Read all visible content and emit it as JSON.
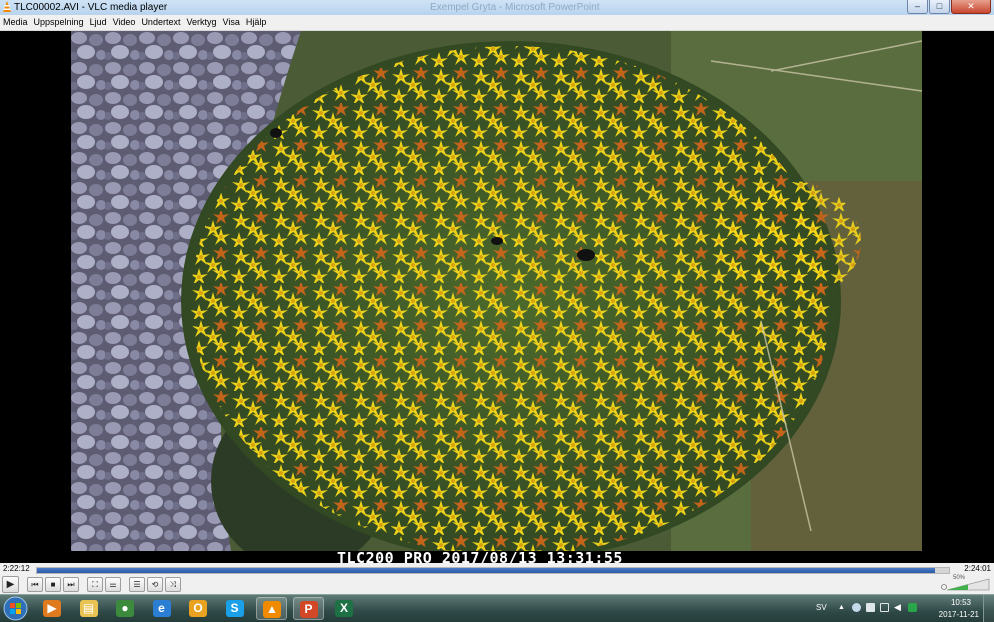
{
  "window": {
    "title": "TLC00002.AVI - VLC media player",
    "background_title": "Exempel Gryta - Microsoft PowerPoint",
    "minimize_glyph": "–",
    "maximize_glyph": "□",
    "close_glyph": "✕"
  },
  "menu": [
    "Media",
    "Uppspelning",
    "Ljud",
    "Video",
    "Undertext",
    "Verktyg",
    "Visa",
    "Hjälp"
  ],
  "video": {
    "osd_text": "TLC200 PRO 2017/08/13 13:31:55"
  },
  "playback": {
    "elapsed": "2:22:12",
    "total": "2:24:01",
    "progress_fraction": 0.985,
    "volume_label": "50%",
    "volume_fraction": 0.5
  },
  "controls": [
    {
      "name": "play-button",
      "glyph": "▶"
    },
    {
      "name": "previous-button",
      "glyph": "⏮"
    },
    {
      "name": "stop-button",
      "glyph": "■"
    },
    {
      "name": "next-button",
      "glyph": "⏭"
    },
    {
      "name": "fullscreen-button",
      "glyph": "⛶"
    },
    {
      "name": "extended-settings-button",
      "glyph": "⚌"
    },
    {
      "name": "playlist-button",
      "glyph": "☰"
    },
    {
      "name": "loop-button",
      "glyph": "⟲"
    },
    {
      "name": "shuffle-button",
      "glyph": "⤨"
    }
  ],
  "taskbar": {
    "apps": [
      {
        "name": "windows-media-player-icon",
        "glyph": "▶",
        "color": "#e07a1f",
        "active": false
      },
      {
        "name": "file-explorer-icon",
        "glyph": "▤",
        "color": "#e8c352",
        "active": false
      },
      {
        "name": "chrome-icon",
        "glyph": "●",
        "color": "#3c8b3c",
        "active": false
      },
      {
        "name": "internet-explorer-icon",
        "glyph": "e",
        "color": "#2a7fd4",
        "active": false
      },
      {
        "name": "outlook-icon",
        "glyph": "O",
        "color": "#e9a21f",
        "active": false
      },
      {
        "name": "skype-icon",
        "glyph": "S",
        "color": "#1aa0e8",
        "active": false
      },
      {
        "name": "vlc-icon",
        "glyph": "▲",
        "color": "#f08a00",
        "active": true
      },
      {
        "name": "powerpoint-icon",
        "glyph": "P",
        "color": "#d24726",
        "active": true
      },
      {
        "name": "excel-icon",
        "glyph": "X",
        "color": "#1e7145",
        "active": false
      }
    ],
    "language": "SV",
    "clock_time": "10:53",
    "clock_date": "2017-11-21"
  },
  "colors": {
    "seek_fill": "#2b5aa6",
    "taskbar": "#2f4a48",
    "flower_yellow": "#f5d91a"
  }
}
